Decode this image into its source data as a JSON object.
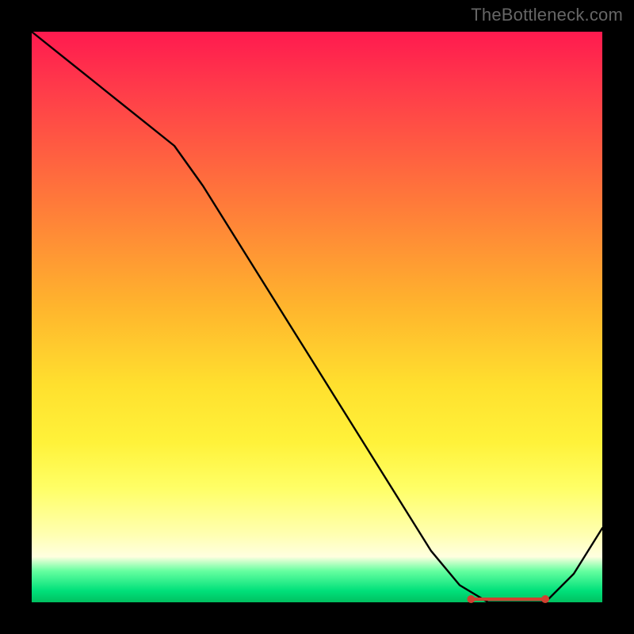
{
  "watermark": "TheBottleneck.com",
  "colors": {
    "frame": "#000000",
    "line": "#000000",
    "marker": "#d04030",
    "gradient_top": "#ff1a4f",
    "gradient_mid": "#ffe02e",
    "gradient_bottom": "#00c060"
  },
  "chart_data": {
    "type": "line",
    "title": "",
    "xlabel": "",
    "ylabel": "",
    "xlim": [
      0,
      100
    ],
    "ylim": [
      0,
      100
    ],
    "grid": false,
    "legend": false,
    "x": [
      0,
      5,
      10,
      15,
      20,
      25,
      30,
      35,
      40,
      45,
      50,
      55,
      60,
      65,
      70,
      75,
      80,
      85,
      90,
      95,
      100
    ],
    "values": [
      100,
      96,
      92,
      88,
      84,
      80,
      73,
      65,
      57,
      49,
      41,
      33,
      25,
      17,
      9,
      3,
      0,
      0,
      0,
      5,
      13
    ],
    "marker_segment": {
      "x_start": 77,
      "x_end": 90,
      "y": 0
    }
  }
}
